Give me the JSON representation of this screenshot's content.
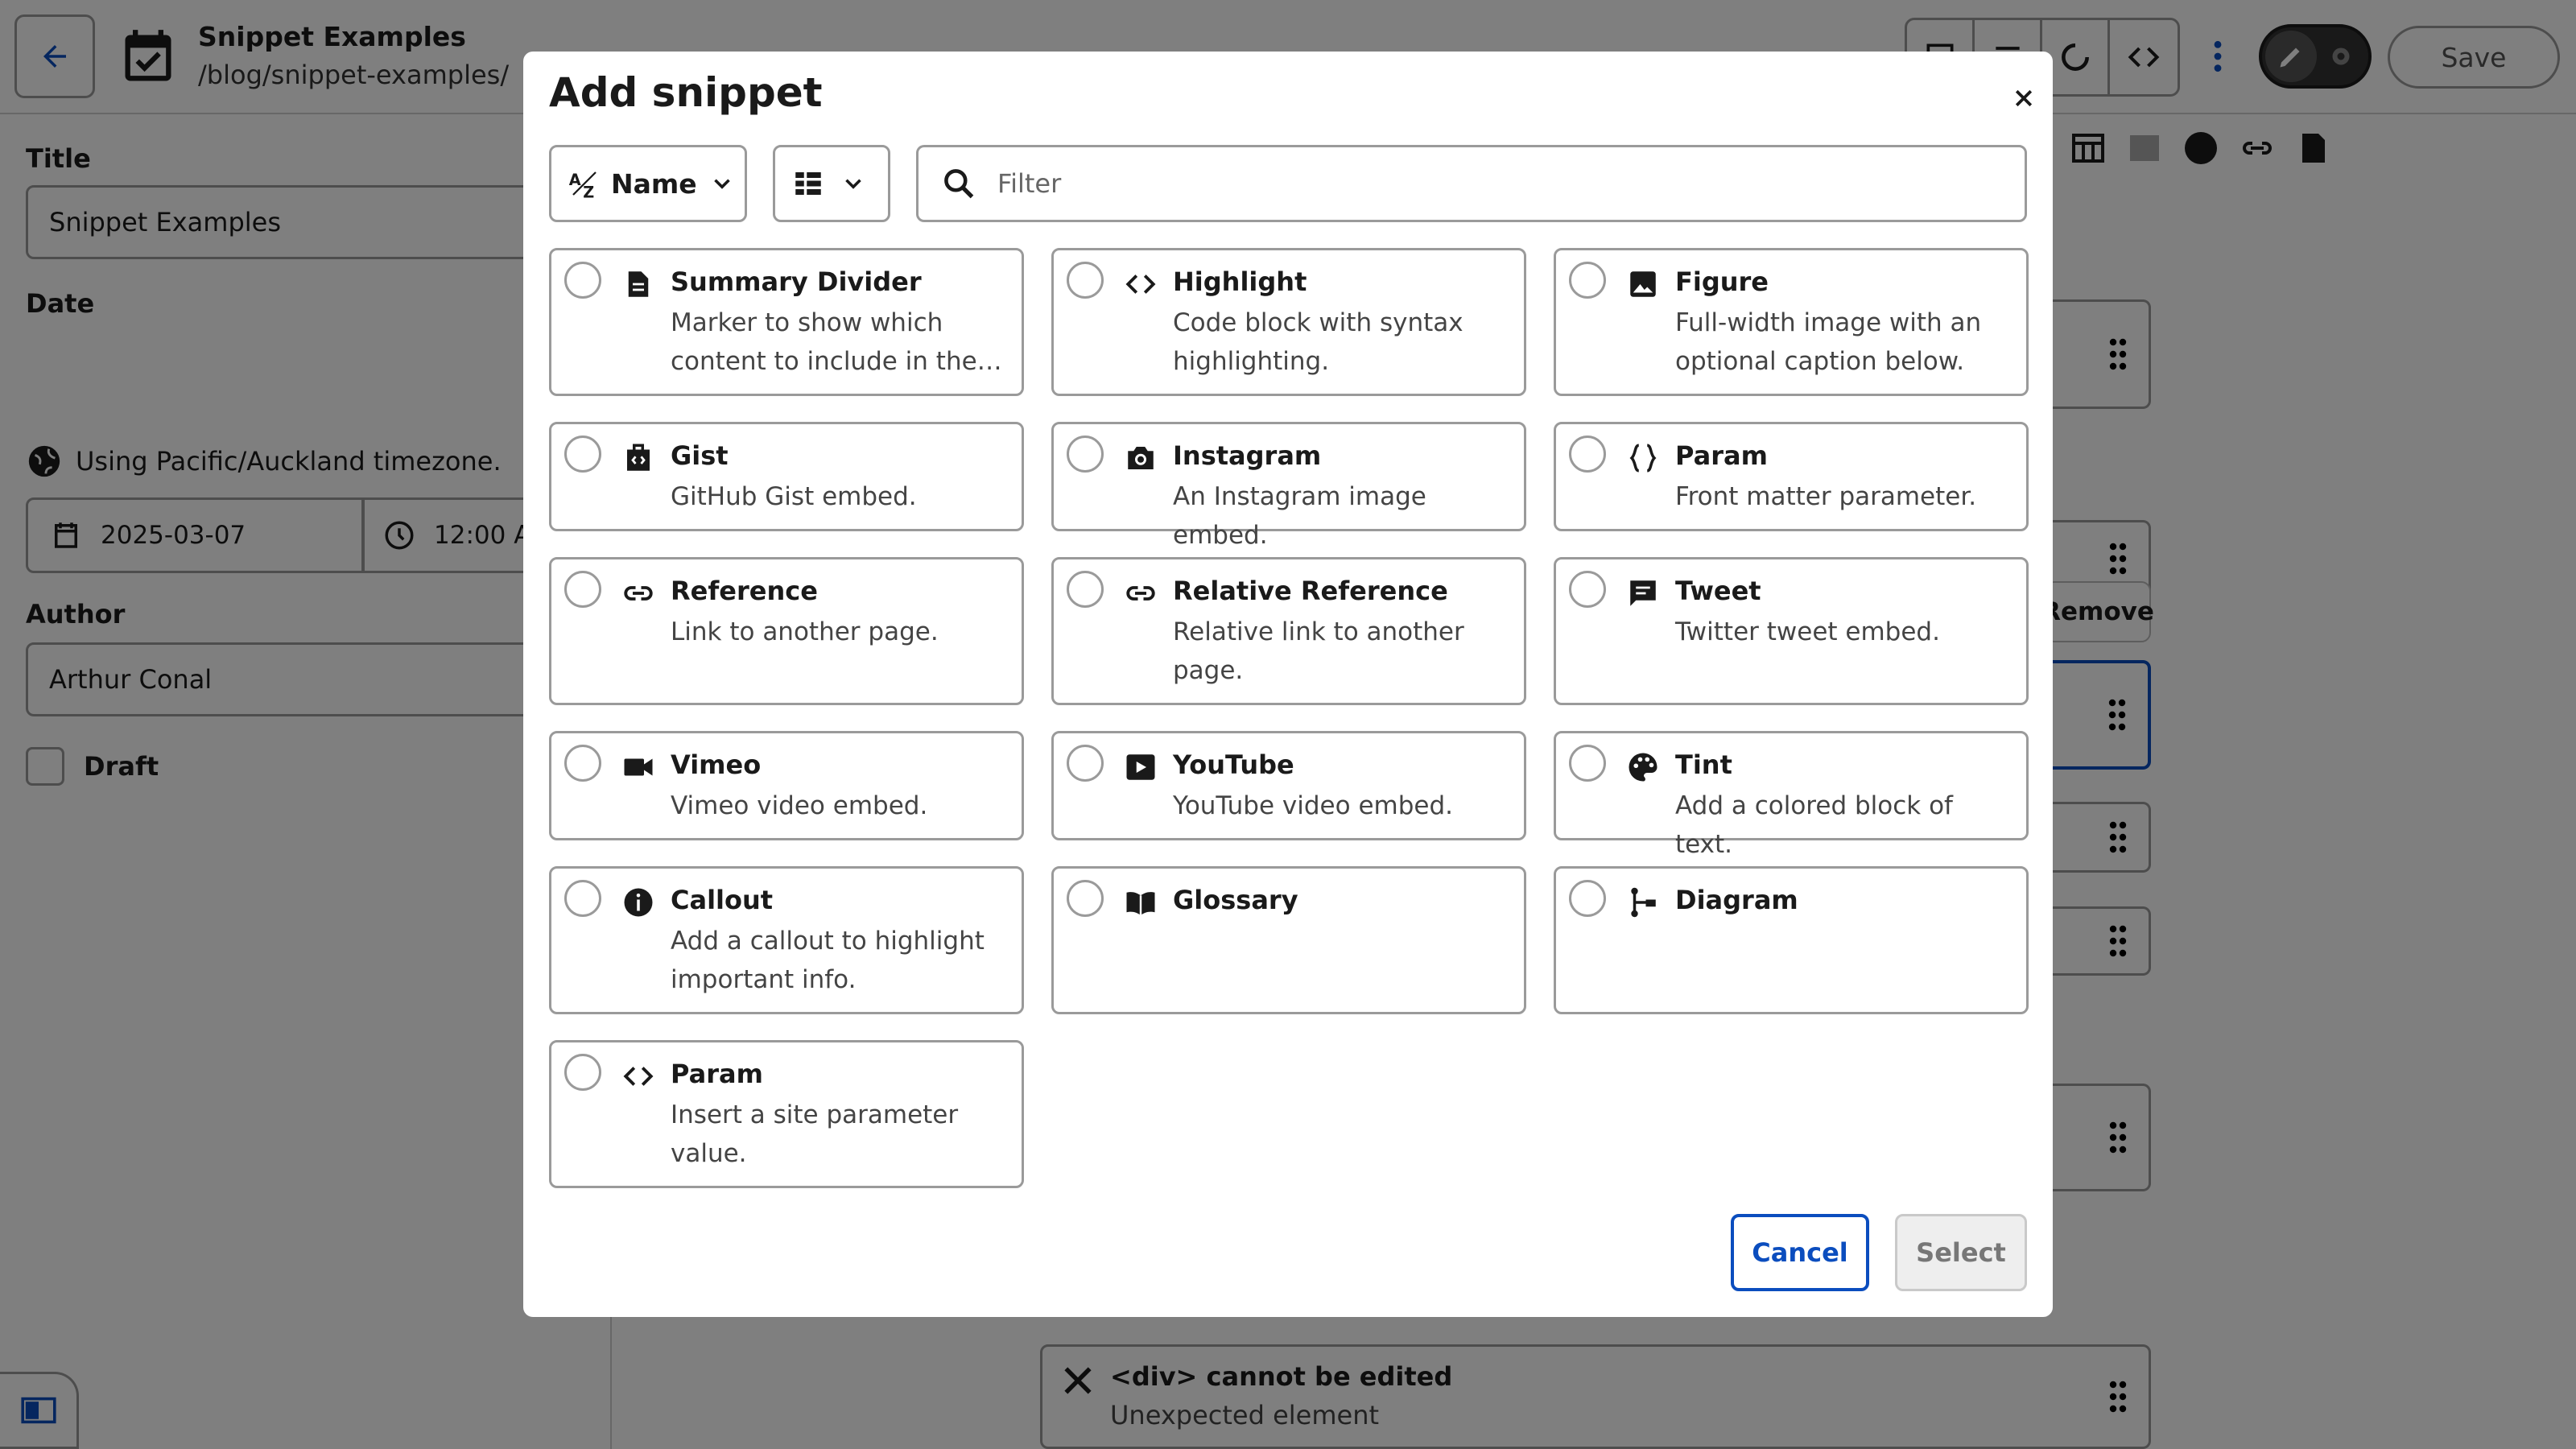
{
  "header": {
    "doc_title": "Snippet Examples",
    "doc_path": "/blog/snippet-examples/",
    "save_label": "Save"
  },
  "sidebar": {
    "title_label": "Title",
    "title_value": "Snippet Examples",
    "date_label": "Date",
    "timezone_text": "Using Pacific/Auckland timezone.",
    "date_value": "2025-03-07",
    "time_value": "12:00 A",
    "author_label": "Author",
    "author_value": "Arthur Conal",
    "draft_label": "Draft"
  },
  "editor": {
    "remove_label": "Remove",
    "div_block_title": "<div> cannot be edited",
    "div_block_sub": "Unexpected element"
  },
  "modal": {
    "title": "Add snippet",
    "sort_label": "Name",
    "filter_placeholder": "Filter",
    "cancel_label": "Cancel",
    "select_label": "Select",
    "snippets": [
      {
        "title": "Summary Divider",
        "desc": "Marker to show which content to include in the…",
        "icon": "summary-divider-icon"
      },
      {
        "title": "Highlight",
        "desc": "Code block with syntax highlighting.",
        "icon": "code-icon"
      },
      {
        "title": "Figure",
        "desc": "Full-width image with an optional caption below.",
        "icon": "image-icon"
      },
      {
        "title": "Gist",
        "desc": "GitHub Gist embed.",
        "icon": "gist-icon"
      },
      {
        "title": "Instagram",
        "desc": "An Instagram image embed.",
        "icon": "camera-icon"
      },
      {
        "title": "Param",
        "desc": "Front matter parameter.",
        "icon": "braces-icon"
      },
      {
        "title": "Reference",
        "desc": "Link to another page.",
        "icon": "link-icon"
      },
      {
        "title": "Relative Reference",
        "desc": "Relative link to another page.",
        "icon": "link-icon"
      },
      {
        "title": "Tweet",
        "desc": "Twitter tweet embed.",
        "icon": "comment-icon"
      },
      {
        "title": "Vimeo",
        "desc": "Vimeo video embed.",
        "icon": "video-camera-icon"
      },
      {
        "title": "YouTube",
        "desc": "YouTube video embed.",
        "icon": "play-icon"
      },
      {
        "title": "Tint",
        "desc": "Add a colored block of text.",
        "icon": "palette-icon"
      },
      {
        "title": "Callout",
        "desc": "Add a callout to highlight important info.",
        "icon": "info-icon"
      },
      {
        "title": "Glossary",
        "desc": "",
        "icon": "book-icon"
      },
      {
        "title": "Diagram",
        "desc": "",
        "icon": "diagram-icon"
      },
      {
        "title": "Param",
        "desc": "Insert a site parameter value.",
        "icon": "code-icon"
      }
    ]
  },
  "colors": {
    "accent": "#0b4dbe",
    "border": "#9a9a9a",
    "overlay": "rgba(0,0,0,0.5)"
  }
}
